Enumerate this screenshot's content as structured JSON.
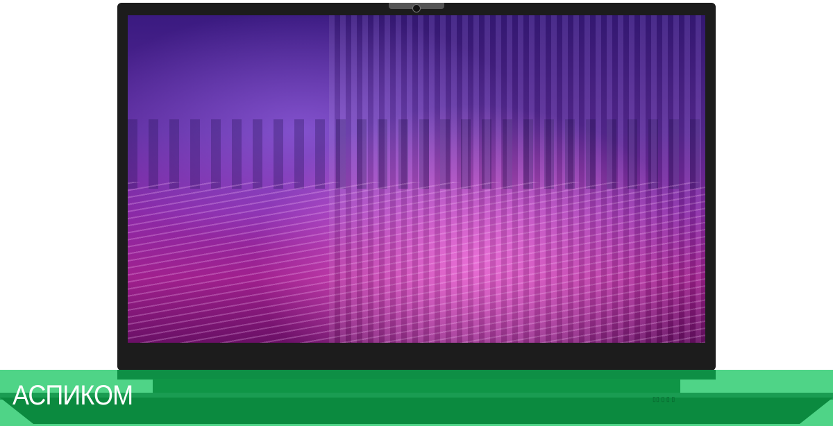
{
  "watermark": {
    "brand": "АСПИКОМ"
  }
}
